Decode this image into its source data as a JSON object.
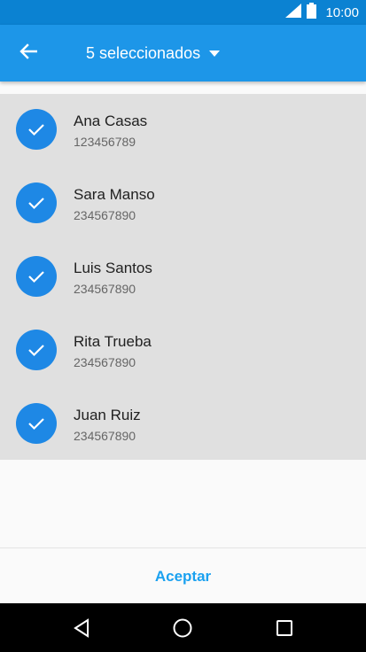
{
  "status_bar": {
    "time": "10:00",
    "icons": [
      "signal-icon",
      "battery-icon"
    ]
  },
  "app_bar": {
    "title": "5 seleccionados",
    "back_icon": "arrow-back-icon",
    "dropdown_icon": "arrow-drop-down-icon"
  },
  "contacts": [
    {
      "name": "Ana Casas",
      "phone": "123456789",
      "selected": true
    },
    {
      "name": "Sara Manso",
      "phone": "234567890",
      "selected": true
    },
    {
      "name": "Luis Santos",
      "phone": "234567890",
      "selected": true
    },
    {
      "name": "Rita Trueba",
      "phone": "234567890",
      "selected": true
    },
    {
      "name": "Juan Ruiz",
      "phone": "234567890",
      "selected": true
    }
  ],
  "footer": {
    "accept_label": "Aceptar"
  },
  "nav_bar": {
    "buttons": [
      "back-triangle-icon",
      "home-circle-icon",
      "recents-square-icon"
    ]
  },
  "colors": {
    "status_bar": "#0b82d2",
    "app_bar": "#1d96e8",
    "check": "#1e88e5",
    "accent_text": "#1aa1f0",
    "list_bg": "#e0e0e0"
  }
}
